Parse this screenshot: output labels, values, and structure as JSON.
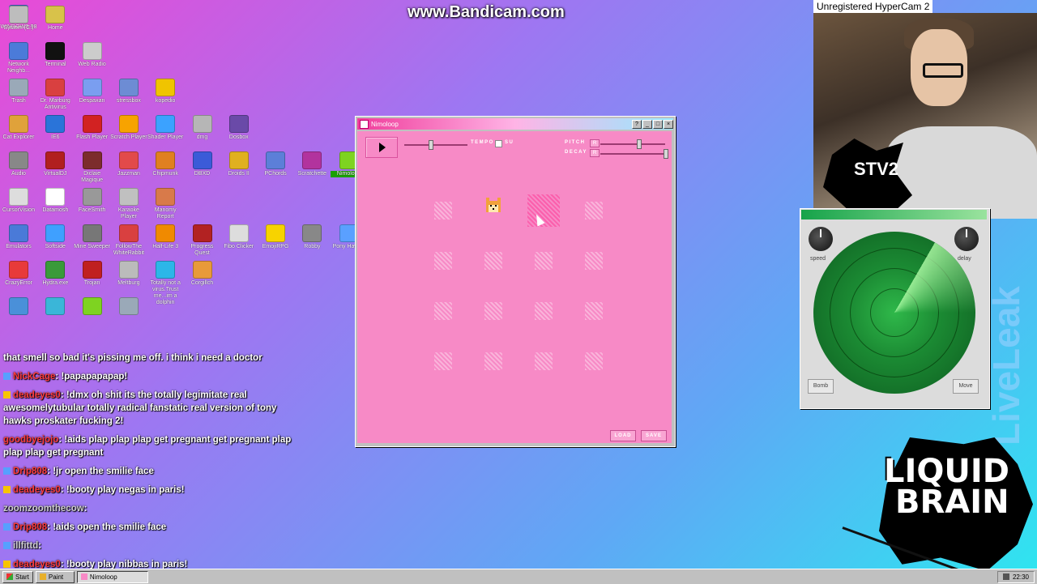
{
  "watermark": "www.Bandicam.com",
  "hypercam_label": "Unregistered HyperCam 2",
  "desktop_icons": [
    {
      "label": "WINDOWS 98",
      "color": "#3a6fd8"
    },
    {
      "label": "System (C:)",
      "color": "#bdbdbd"
    },
    {
      "label": "Home",
      "color": "#d8c24a"
    },
    {
      "label": "Network Neighb...",
      "color": "#4b7bd9"
    },
    {
      "label": "Terminal",
      "color": "#111111"
    },
    {
      "label": "Web Radio",
      "color": "#cccccc"
    },
    {
      "label": "Trash",
      "color": "#9aa9b8"
    },
    {
      "label": "Dr. Marburg Antivirus",
      "color": "#d94040"
    },
    {
      "label": "Despaxan",
      "color": "#7a9ef0"
    },
    {
      "label": "stressbox",
      "color": "#6d8cd4"
    },
    {
      "label": "kopedio",
      "color": "#f0c400"
    },
    {
      "label": "Cat Explorer",
      "color": "#e0a23a"
    },
    {
      "label": "IE6",
      "color": "#2a74d9"
    },
    {
      "label": "Flash Player",
      "color": "#d22222"
    },
    {
      "label": "Scratch Player",
      "color": "#f7a300"
    },
    {
      "label": "Shader Player",
      "color": "#3ba2ff"
    },
    {
      "label": "dmg",
      "color": "#b6b6b6"
    },
    {
      "label": "Dosbox",
      "color": "#6a4aa8"
    },
    {
      "label": "Audio",
      "color": "#888888"
    },
    {
      "label": "VirtualDJ",
      "color": "#b11f1f"
    },
    {
      "label": "Diclaie Magique",
      "color": "#7c2c2c"
    },
    {
      "label": "Jazzman",
      "color": "#e24a4a"
    },
    {
      "label": "Chipmunk",
      "color": "#e08020"
    },
    {
      "label": "DBXD",
      "color": "#3b5bd8"
    },
    {
      "label": "Droids II",
      "color": "#e0b020"
    },
    {
      "label": "PChords",
      "color": "#5c7fd8"
    },
    {
      "label": "Scratchette",
      "color": "#b2339e"
    },
    {
      "label": "Nimoloop",
      "color": "#7ed321"
    },
    {
      "label": "CursorVision",
      "color": "#dddddd"
    },
    {
      "label": "Datamosh",
      "color": "#ffffff"
    },
    {
      "label": "FaceSmith",
      "color": "#999999"
    },
    {
      "label": "Karaoke Player",
      "color": "#c0c0c0"
    },
    {
      "label": "Manomy Report",
      "color": "#d87a4a"
    },
    {
      "label": "Emulators",
      "color": "#4a7ad8"
    },
    {
      "label": "Softside",
      "color": "#3fa0ff"
    },
    {
      "label": "Mine Sweeper",
      "color": "#777777"
    },
    {
      "label": "FollowThe WhiteRabbit",
      "color": "#d94040"
    },
    {
      "label": "Half-Life 3",
      "color": "#f08a00"
    },
    {
      "label": "Progress Quest",
      "color": "#b22222"
    },
    {
      "label": "Fibo Clicker",
      "color": "#dddddd"
    },
    {
      "label": "EmojiRPG",
      "color": "#f7d300"
    },
    {
      "label": "Robby",
      "color": "#888888"
    },
    {
      "label": "Pony Hawk's",
      "color": "#5aa0ff"
    },
    {
      "label": "CrazyError",
      "color": "#e83a3a"
    },
    {
      "label": "Hydra.exe",
      "color": "#3a9a3a"
    },
    {
      "label": "Trojan",
      "color": "#c02020"
    },
    {
      "label": "Meltburg",
      "color": "#bbbbbb"
    },
    {
      "label": "Totally not a virus.Trust me...im a dolphin",
      "color": "#2cb6e8"
    },
    {
      "label": "Corgillch",
      "color": "#e89a3a"
    },
    {
      "label": "",
      "color": "#4a90d9"
    },
    {
      "label": "",
      "color": "#3ab6d8"
    },
    {
      "label": "",
      "color": "#7ed321"
    },
    {
      "label": "",
      "color": "#9aa9b8"
    }
  ],
  "chat": [
    {
      "user": "",
      "text": "that smell so bad it's pissing me off. i think i need a doctor",
      "badge": ""
    },
    {
      "user": "NickCage",
      "text": "!papapapapap!",
      "badge": "b"
    },
    {
      "user": "deadeyes0",
      "text": "!dmx oh shit its the totally legimitate real awesomelytubular totally radical fanstatic real version of tony hawks proskater fucking 2!",
      "badge": "y"
    },
    {
      "user": "goodbyejojo",
      "text": "!aids plap plap plap get pregnant get pregnant plap plap plap get pregnant",
      "badge": ""
    },
    {
      "user": "Drip808",
      "text": "!jr open the smilie face",
      "badge": "b"
    },
    {
      "user": "deadeyes0",
      "text": "!booty play negas in paris!",
      "badge": "y"
    },
    {
      "user": "zoomzoomthecow",
      "text": "",
      "badge": "",
      "gray": true
    },
    {
      "user": "Drip808",
      "text": "!aids open the smilie face",
      "badge": "b"
    },
    {
      "user": "illfittd",
      "text": "",
      "badge": "b",
      "gray": true
    },
    {
      "user": "deadeyes0",
      "text": "!booty play nibbas in paris!",
      "badge": "y"
    }
  ],
  "window": {
    "title": "Nimoloop",
    "controls": {
      "help": "?",
      "minimize": "_",
      "maximize": "□",
      "close": "×"
    },
    "tempo_label": "TEMPO",
    "su_label": "SU",
    "pitch_label": "PITCH",
    "decay_label": "DECAY",
    "reset_label": "R",
    "load_label": "LOAD",
    "save_label": "SAVE",
    "grid_rows": 4,
    "grid_cols": 4,
    "active_cell": {
      "row": 0,
      "col": 1
    },
    "highlight_cell": {
      "row": 0,
      "col": 2
    }
  },
  "radar": {
    "speed_label": "speed",
    "delay_label": "delay",
    "left_button": "Bomb",
    "right_button": "Move"
  },
  "overlays": {
    "liveleak": "LiveLeak",
    "brand_line1": "LIQUID",
    "brand_line2": "BRAIN",
    "stv": "STV2"
  },
  "taskbar": {
    "start_label": "Start",
    "items": [
      "Paint",
      "Nimoloop"
    ],
    "clock": "22:30"
  }
}
